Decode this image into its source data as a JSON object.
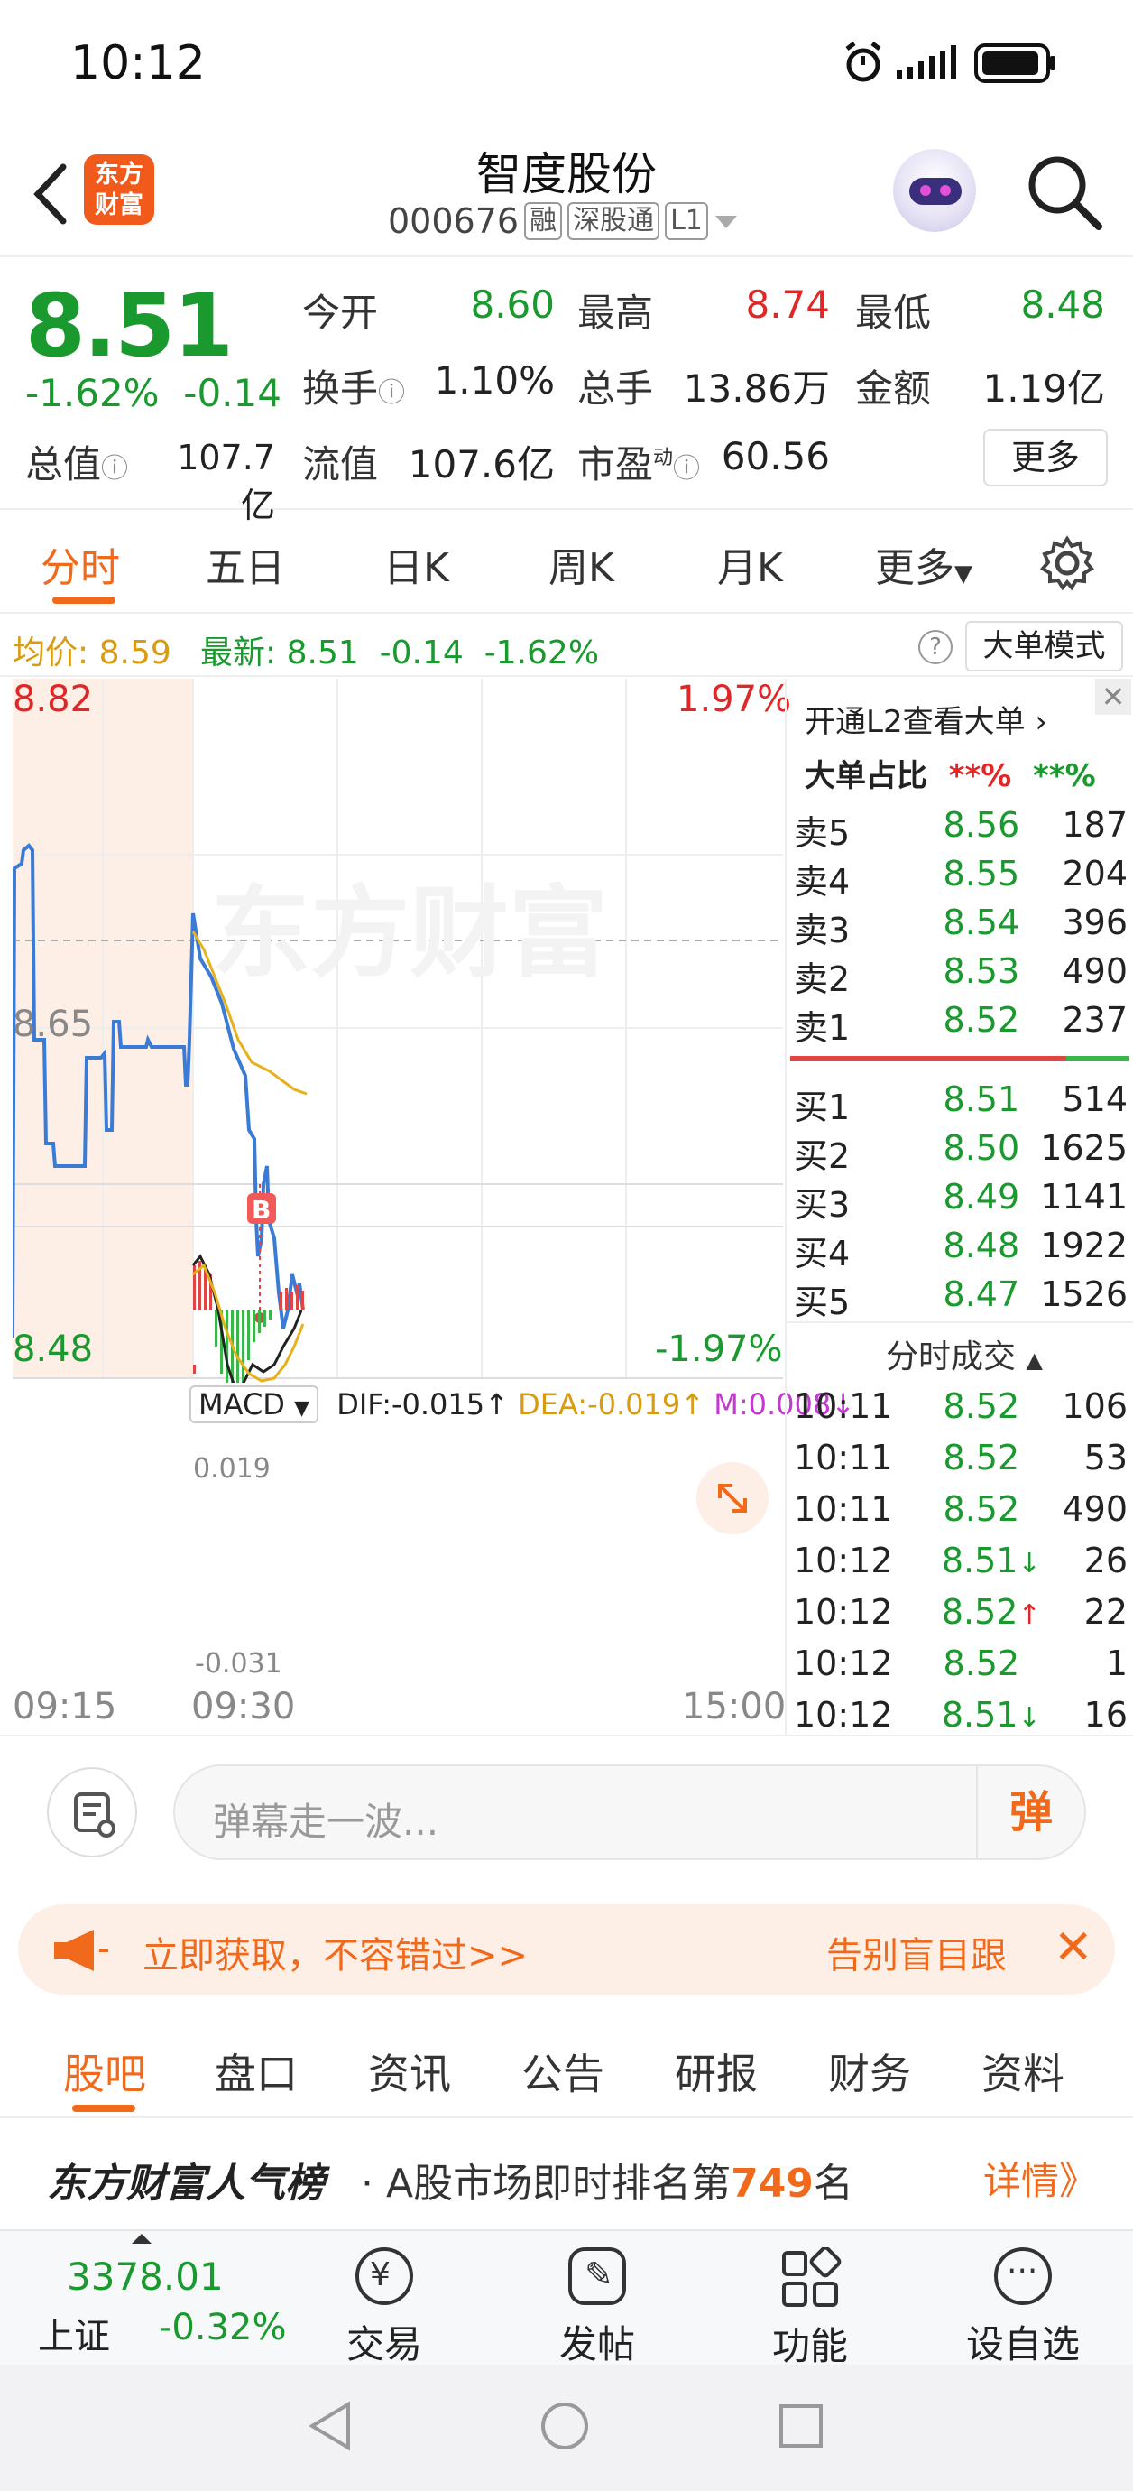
{
  "status_bar": {
    "time": "10:12"
  },
  "header": {
    "logo_text": "东方财富",
    "stock_name": "智度股份",
    "stock_code": "000676",
    "tags": [
      "融",
      "深股通",
      "L1"
    ]
  },
  "quote": {
    "price": "8.51",
    "change_pct": "-1.62%",
    "change": "-0.14",
    "fields": [
      {
        "label": "今开",
        "value": "8.60"
      },
      {
        "label": "最高",
        "value": "8.74"
      },
      {
        "label": "最低",
        "value": "8.48"
      },
      {
        "label": "换手",
        "value": "1.10%"
      },
      {
        "label": "总手",
        "value": "13.86万"
      },
      {
        "label": "金额",
        "value": "1.19亿"
      },
      {
        "label": "总值",
        "value": "107.7亿"
      },
      {
        "label": "流值",
        "value": "107.6亿"
      },
      {
        "label": "市盈",
        "value": "60.56"
      }
    ],
    "pe_superscript": "动",
    "more_label": "更多"
  },
  "chart_tabs": [
    "分时",
    "五日",
    "日K",
    "周K",
    "月K",
    "更多"
  ],
  "info_row": {
    "avg_label": "均价:",
    "avg_value": "8.59",
    "latest_label": "最新:",
    "latest_value": "8.51",
    "latest_change": "-0.14",
    "latest_pct": "-1.62%",
    "help": "?",
    "mode_button": "大单模式"
  },
  "chart_labels": {
    "price_high": "8.82",
    "price_mid": "8.65",
    "price_low": "8.48",
    "pct_high": "1.97%",
    "pct_low": "-1.97%",
    "watermark": "东方财富",
    "buy_marker": "B",
    "macd_select": "MACD",
    "dif": "DIF:-0.015",
    "dea": "DEA:-0.019",
    "m": "M:0.008",
    "macd_high": "0.019",
    "macd_low": "-0.031",
    "time_start": "09:15",
    "time_open": "09:30",
    "time_end": "15:00"
  },
  "chart_data": {
    "type": "line",
    "ylim": [
      8.48,
      8.82
    ],
    "series": [
      {
        "name": "price",
        "x_note": "",
        "values": [
          8.76,
          8.76,
          8.52,
          8.52,
          8.5,
          8.5,
          8.58,
          8.58,
          8.6,
          8.6,
          8.6,
          8.71,
          8.66,
          8.6,
          8.56,
          8.53,
          8.49,
          8.52,
          8.51
        ]
      },
      {
        "name": "avg",
        "values": [
          8.7,
          8.68,
          8.65,
          8.63,
          8.62
        ]
      }
    ]
  },
  "right_panel": {
    "promo": "开通L2查看大单 ›",
    "big_ratio_label": "大单占比",
    "big_ratio_red": "**%",
    "big_ratio_green": "**%",
    "asks": [
      {
        "label": "卖5",
        "price": "8.56",
        "vol": "187"
      },
      {
        "label": "卖4",
        "price": "8.55",
        "vol": "204"
      },
      {
        "label": "卖3",
        "price": "8.54",
        "vol": "396"
      },
      {
        "label": "卖2",
        "price": "8.53",
        "vol": "490"
      },
      {
        "label": "卖1",
        "price": "8.52",
        "vol": "237"
      }
    ],
    "bids": [
      {
        "label": "买1",
        "price": "8.51",
        "vol": "514"
      },
      {
        "label": "买2",
        "price": "8.50",
        "vol": "1625"
      },
      {
        "label": "买3",
        "price": "8.49",
        "vol": "1141"
      },
      {
        "label": "买4",
        "price": "8.48",
        "vol": "1922"
      },
      {
        "label": "买5",
        "price": "8.47",
        "vol": "1526"
      }
    ],
    "trades_title": "分时成交",
    "trades": [
      {
        "time": "10:11",
        "price": "8.52",
        "vol": "106",
        "dir": "",
        "vol_color": "red"
      },
      {
        "time": "10:11",
        "price": "8.52",
        "vol": "53",
        "dir": "",
        "vol_color": "red"
      },
      {
        "time": "10:11",
        "price": "8.52",
        "vol": "490",
        "dir": "",
        "vol_color": "green"
      },
      {
        "time": "10:12",
        "price": "8.51",
        "vol": "26",
        "dir": "↓",
        "vol_color": "green"
      },
      {
        "time": "10:12",
        "price": "8.52",
        "vol": "22",
        "dir": "↑",
        "vol_color": "red"
      },
      {
        "time": "10:12",
        "price": "8.52",
        "vol": "1",
        "dir": "",
        "vol_color": "red"
      },
      {
        "time": "10:12",
        "price": "8.51",
        "vol": "16",
        "dir": "↓",
        "vol_color": "green"
      }
    ]
  },
  "comment": {
    "placeholder": "弹幕走一波...",
    "danmu": "弹"
  },
  "banner": {
    "text": "立即获取，不容错过>>",
    "text2": "告别盲目跟"
  },
  "bottom_tabs": [
    "股吧",
    "盘口",
    "资讯",
    "公告",
    "研报",
    "财务",
    "资料"
  ],
  "rank": {
    "brand": "东方财富人气榜",
    "desc_prefix": "· A股市场即时排名第",
    "rank_num": "749",
    "desc_suffix": "名",
    "detail": "详情》"
  },
  "bottom_bar": {
    "index_value": "3378.01",
    "index_name": "上证",
    "index_pct": "-0.32%",
    "items": [
      "交易",
      "发帖",
      "功能",
      "设自选"
    ]
  }
}
